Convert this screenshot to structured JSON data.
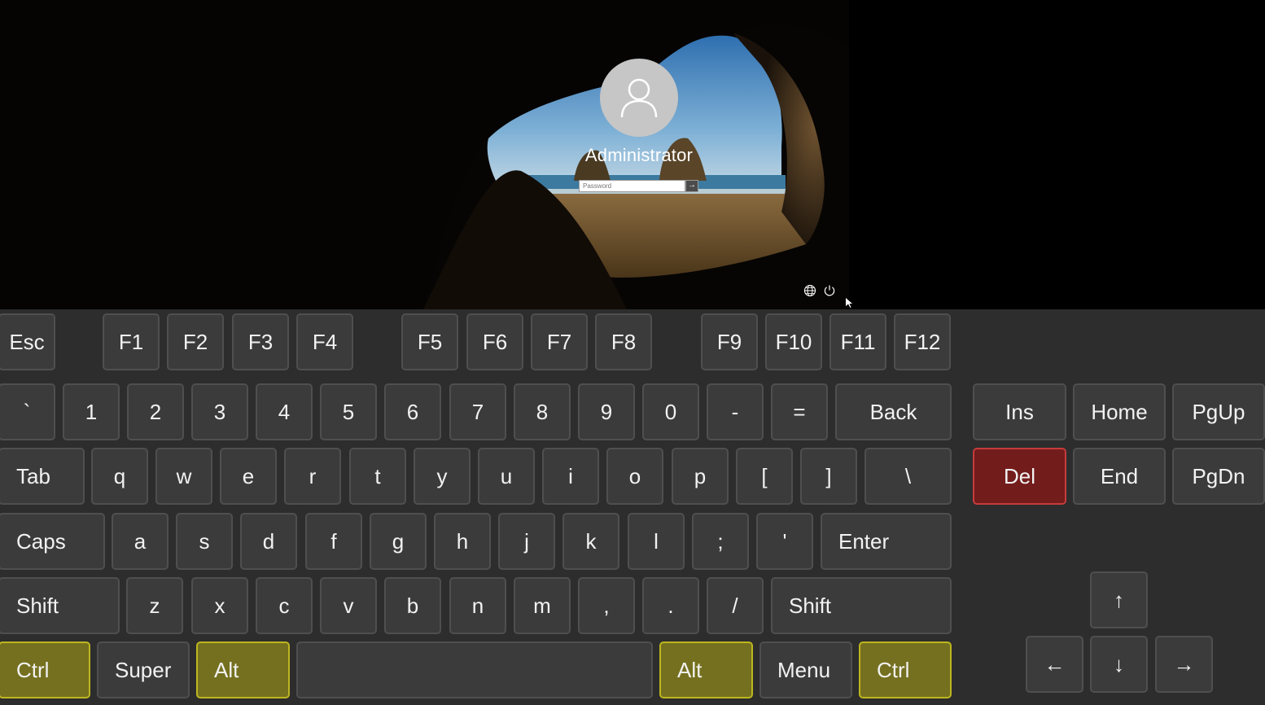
{
  "lock_screen": {
    "username": "Administrator",
    "password_placeholder": "Password",
    "submit_icon": "arrow-right-icon",
    "submit_glyph": "→",
    "bottom_icons": [
      "globe-icon",
      "power-icon"
    ]
  },
  "keyboard": {
    "function_row": [
      "Esc",
      "F1",
      "F2",
      "F3",
      "F4",
      "F5",
      "F6",
      "F7",
      "F8",
      "F9",
      "F10",
      "F11",
      "F12"
    ],
    "number_row": [
      "`",
      "1",
      "2",
      "3",
      "4",
      "5",
      "6",
      "7",
      "8",
      "9",
      "0",
      "-",
      "=",
      "Back"
    ],
    "top_row": [
      "Tab",
      "q",
      "w",
      "e",
      "r",
      "t",
      "y",
      "u",
      "i",
      "o",
      "p",
      "[",
      "]",
      "\\"
    ],
    "home_row": [
      "Caps",
      "a",
      "s",
      "d",
      "f",
      "g",
      "h",
      "j",
      "k",
      "l",
      ";",
      "'",
      "Enter"
    ],
    "shift_row": [
      "Shift",
      "z",
      "x",
      "c",
      "v",
      "b",
      "n",
      "m",
      ",",
      ".",
      "/",
      "Shift"
    ],
    "bottom_row": [
      "Ctrl",
      "Super",
      "Alt",
      "",
      "Alt",
      "Menu",
      "Ctrl"
    ],
    "nav_cluster": [
      "Ins",
      "Home",
      "PgUp",
      "Del",
      "End",
      "PgDn"
    ],
    "arrows": [
      "↑",
      "←",
      "↓",
      "→"
    ],
    "active_modifiers": [
      "Ctrl",
      "Alt"
    ],
    "colors": {
      "key": "#3b3b3b",
      "key_border": "#4f4f4f",
      "modifier_active": "#75701f",
      "modifier_active_border": "#bdb61f",
      "del_key": "#731c1c",
      "del_key_border": "#c63b3b"
    }
  }
}
